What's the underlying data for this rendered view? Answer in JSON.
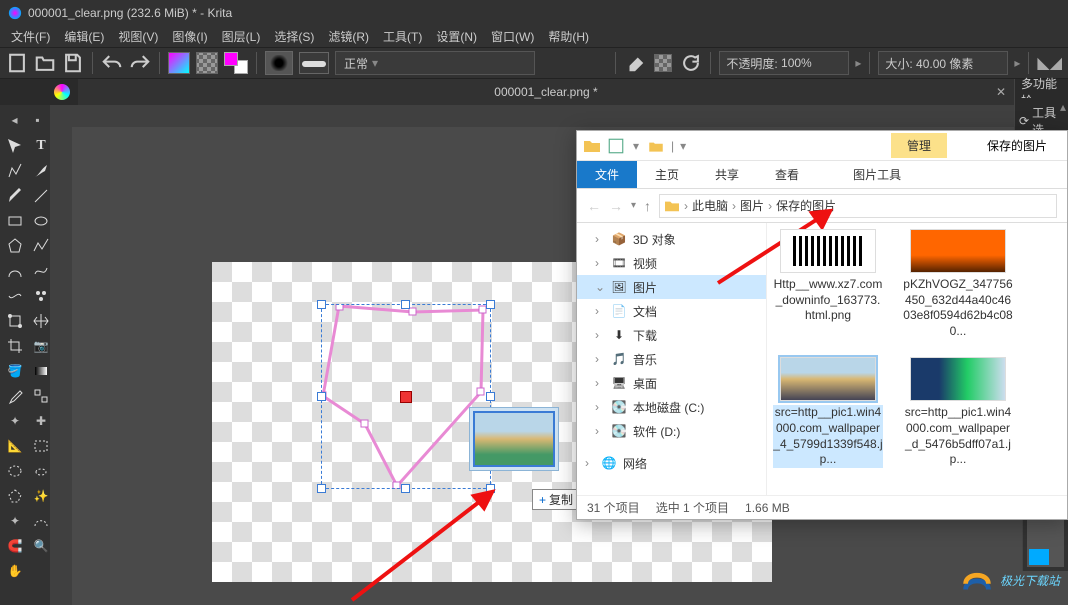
{
  "window": {
    "title": "000001_clear.png (232.6 MiB)  * - Krita"
  },
  "menu": {
    "file": "文件(F)",
    "edit": "编辑(E)",
    "view": "视图(V)",
    "image": "图像(I)",
    "layer": "图层(L)",
    "select": "选择(S)",
    "filter": "滤镜(R)",
    "tools": "工具(T)",
    "settings": "设置(N)",
    "window": "窗口(W)",
    "help": "帮助(H)"
  },
  "toolbar": {
    "blend_label": "正常",
    "opacity_label": "不透明度:",
    "opacity_value": "100%",
    "size_label": "大小:",
    "size_value": "40.00 像素"
  },
  "tab": {
    "doc_title": "000001_clear.png *"
  },
  "right_panel": {
    "title": "多功能拾",
    "tool_label": "工具选"
  },
  "drag": {
    "copy": "复制"
  },
  "explorer": {
    "manage_tab": "管理",
    "location_name": "保存的图片",
    "ribbon": {
      "file": "文件",
      "home": "主页",
      "share": "共享",
      "view": "查看",
      "picture_tools": "图片工具"
    },
    "path": {
      "seg1": "此电脑",
      "seg2": "图片",
      "seg3": "保存的图片"
    },
    "tree": {
      "items": [
        {
          "icon": "cube",
          "label": "3D 对象"
        },
        {
          "icon": "film",
          "label": "视频"
        },
        {
          "icon": "image",
          "label": "图片",
          "selected": true
        },
        {
          "icon": "doc",
          "label": "文档"
        },
        {
          "icon": "down",
          "label": "下载"
        },
        {
          "icon": "music",
          "label": "音乐"
        },
        {
          "icon": "desktop",
          "label": "桌面"
        },
        {
          "icon": "disk",
          "label": "本地磁盘 (C:)"
        },
        {
          "icon": "disk",
          "label": "软件 (D:)"
        }
      ],
      "network": "网络"
    },
    "files": [
      {
        "thumb": "qr",
        "name": "Http__www.xz7.com_downinfo_163773.html.png"
      },
      {
        "thumb": "orange",
        "name": "pKZhVOGZ_347756450_632d44a40c4603e8f0594d62b4c080..."
      },
      {
        "thumb": "river",
        "name": "src=http__pic1.win4000.com_wallpaper_4_5799d1339f548.jp...",
        "selected": true
      },
      {
        "thumb": "falls",
        "name": "src=http__pic1.win4000.com_wallpaper_d_5476b5dff07a1.jp..."
      }
    ],
    "status": {
      "count": "31 个项目",
      "selected": "选中 1 个项目",
      "size": "1.66 MB"
    }
  },
  "watermark": {
    "text": "极光下载站"
  }
}
